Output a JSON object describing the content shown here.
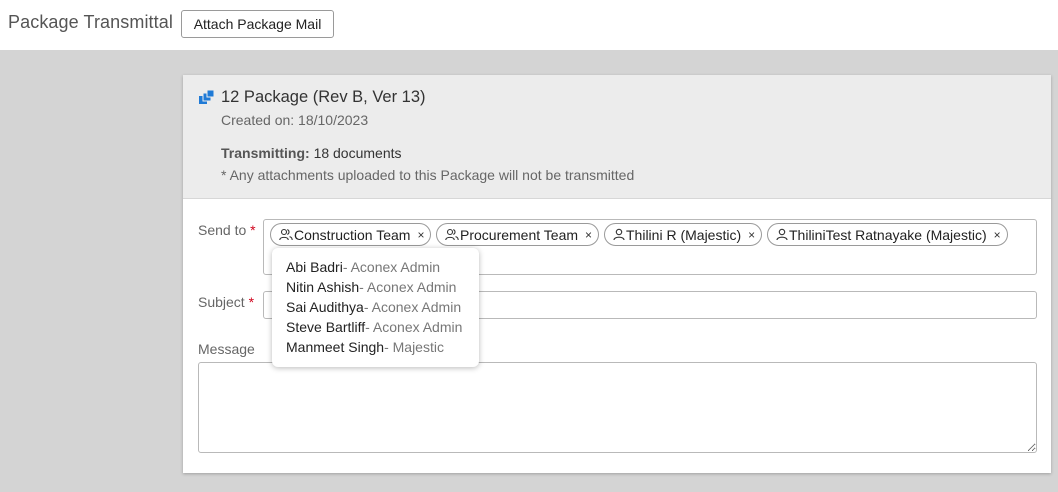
{
  "header": {
    "title": "Package Transmittal",
    "attach_button": "Attach Package Mail"
  },
  "package": {
    "icon": "package-stack-icon",
    "accent_color": "#1f7ad6",
    "title": "12 Package (Rev B, Ver 13)",
    "created": "Created on: 18/10/2023",
    "transmitting_label": "Transmitting:",
    "transmitting_count": "18 documents",
    "note": "* Any attachments uploaded to this Package will not be transmitted"
  },
  "form": {
    "sendto_label": "Send to",
    "subject_label": "Subject",
    "message_label": "Message",
    "required_marker": "*",
    "required_color": "#d0021b",
    "recipients": [
      {
        "label": "Construction Team",
        "icon": "group-icon",
        "remove": "×"
      },
      {
        "label": "Procurement Team",
        "icon": "group-icon",
        "remove": "×"
      },
      {
        "label": "Thilini R (Majestic)",
        "icon": "user-icon",
        "remove": "×"
      },
      {
        "label": "ThiliniTest Ratnayake (Majestic)",
        "icon": "user-icon",
        "remove": "×"
      }
    ],
    "subject_value": "",
    "message_value": ""
  },
  "suggestions": [
    {
      "name": "Abi Badri",
      "org": "- Aconex Admin"
    },
    {
      "name": "Nitin Ashish",
      "org": "- Aconex Admin"
    },
    {
      "name": "Sai Audithya",
      "org": "- Aconex Admin"
    },
    {
      "name": "Steve Bartliff",
      "org": "- Aconex Admin"
    },
    {
      "name": "Manmeet Singh",
      "org": "- Majestic"
    }
  ]
}
